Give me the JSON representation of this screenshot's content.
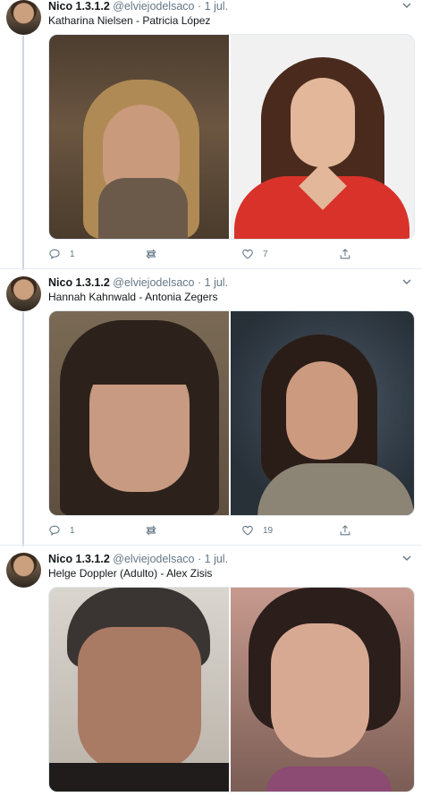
{
  "tweets": [
    {
      "author": "Nico 1.3.1.2",
      "handle": "@elviejodelsaco",
      "dot": "·",
      "date": "1 jul.",
      "text": "Katharina Nielsen - Patricia López",
      "replies": "1",
      "retweets": "",
      "likes": "7"
    },
    {
      "author": "Nico 1.3.1.2",
      "handle": "@elviejodelsaco",
      "dot": "·",
      "date": "1 jul.",
      "text": "Hannah Kahnwald - Antonia Zegers",
      "replies": "1",
      "retweets": "",
      "likes": "19"
    },
    {
      "author": "Nico 1.3.1.2",
      "handle": "@elviejodelsaco",
      "dot": "·",
      "date": "1 jul.",
      "text": "Helge Doppler (Adulto) - Alex Zisis"
    }
  ],
  "icons": [
    "reply-icon",
    "retweet-icon",
    "like-icon",
    "share-icon",
    "chevron-down-icon"
  ],
  "colors": {
    "text": "#14171a",
    "secondary": "#657786",
    "border": "#e6ecf0"
  }
}
